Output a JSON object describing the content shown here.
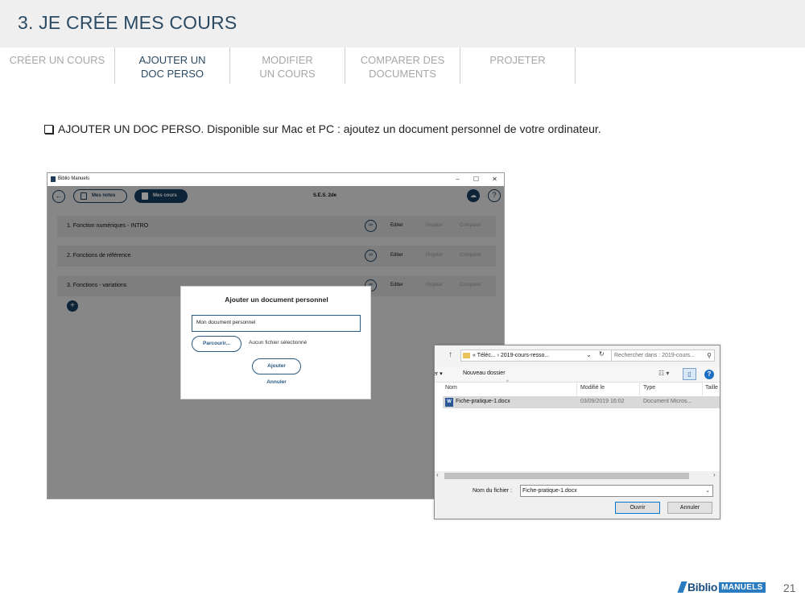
{
  "slide": {
    "title": "3. JE CRÉE MES COURS",
    "page_number": "21",
    "instruction": "AJOUTER UN DOC PERSO. Disponible sur Mac et PC : ajoutez un document personnel de votre ordinateur."
  },
  "tabs": [
    {
      "line1": "CRÉER UN COURS",
      "line2": "",
      "active": false
    },
    {
      "line1": "AJOUTER UN",
      "line2": "DOC PERSO",
      "active": true
    },
    {
      "line1": "MODIFIER",
      "line2": "UN COURS",
      "active": false
    },
    {
      "line1": "COMPARER DES",
      "line2": "DOCUMENTS",
      "active": false
    },
    {
      "line1": "PROJETER",
      "line2": "",
      "active": false
    }
  ],
  "app": {
    "window_title": "Biblio Manuels",
    "controls": {
      "minimize": "–",
      "maximize": "☐",
      "close": "✕"
    },
    "toolbar": {
      "mes_notes": "Mes notes",
      "mes_cours": "Mes cours",
      "course_title": "S.E.S. 2de",
      "help": "?"
    },
    "rows": [
      {
        "name": "1. Fonction numériques - INTRO",
        "edit": "Editer",
        "project": "Projeter",
        "compare": "Comparer"
      },
      {
        "name": "2. Fonctions de référence",
        "edit": "Editer",
        "project": "Projeter",
        "compare": "Comparer"
      },
      {
        "name": "3. Fonctions - variations",
        "edit": "Editer",
        "project": "Projeter",
        "compare": "Comparer"
      }
    ],
    "add_button": "+"
  },
  "add_dialog": {
    "title": "Ajouter un document personnel",
    "input_value": "Mon document personnel",
    "browse": "Parcourir...",
    "no_file": "Aucun fichier sélectionné",
    "submit": "Ajouter",
    "cancel": "Annuler"
  },
  "file_dialog": {
    "path": "« Téléc...  ›  2019-cours-resso...",
    "search_placeholder": "Rechercher dans : 2019-cours...",
    "cmd_left": "er ▾",
    "new_folder": "Nouveau dossier",
    "columns": {
      "name": "Nom",
      "modified": "Modifié le",
      "type": "Type",
      "size": "Taille"
    },
    "files": [
      {
        "name": "Fiche-pratique-1.docx",
        "modified": "03/09/2019 16:02",
        "type": "Document Micros..."
      }
    ],
    "filename_label": "Nom du fichier :",
    "filename_value": "Fiche-pratique-1.docx",
    "open": "Ouvrir",
    "cancel": "Annuler"
  },
  "brand": {
    "biblio": "Biblio",
    "manuels": "MANUELS"
  },
  "colors": {
    "title": "#2b4a63",
    "app_primary": "#173d5f",
    "brand_blue": "#2b7bc0"
  }
}
